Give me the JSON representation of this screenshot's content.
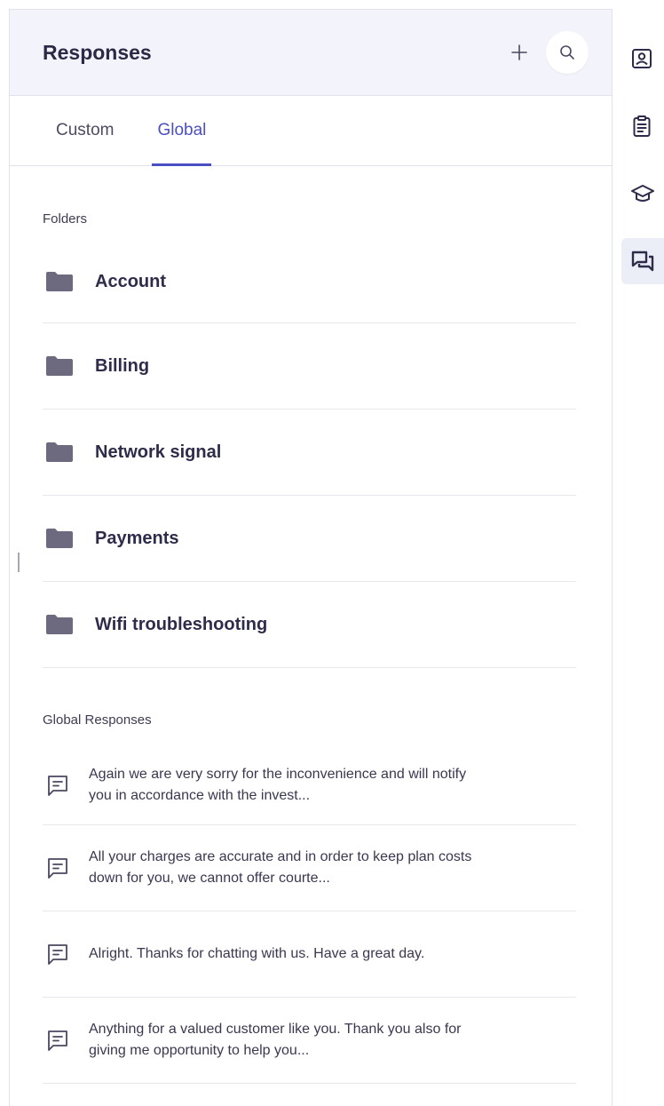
{
  "header": {
    "title": "Responses"
  },
  "tabs": [
    {
      "label": "Custom",
      "active": false
    },
    {
      "label": "Global",
      "active": true
    }
  ],
  "folders": {
    "label": "Folders",
    "items": [
      {
        "name": "Account"
      },
      {
        "name": "Billing"
      },
      {
        "name": "Network signal"
      },
      {
        "name": "Payments"
      },
      {
        "name": "Wifi troubleshooting"
      }
    ]
  },
  "global_responses": {
    "label": "Global Responses",
    "items": [
      {
        "text": "Again we are very sorry for the inconvenience and will notify you in accordance with the invest..."
      },
      {
        "text": "All your charges are accurate and in order to keep plan costs down for you, we cannot offer courte..."
      },
      {
        "text": "Alright. Thanks for chatting with us. Have a great day."
      },
      {
        "text": "Anything for a valued customer like you. Thank you also for giving me opportunity to help you..."
      }
    ]
  },
  "rail": [
    {
      "icon": "contact-card-icon",
      "active": false
    },
    {
      "icon": "clipboard-icon",
      "active": false
    },
    {
      "icon": "graduation-cap-icon",
      "active": false
    },
    {
      "icon": "chat-bubbles-icon",
      "active": true
    }
  ],
  "colors": {
    "accent": "#4b4fc2",
    "header_bg": "#f3f4fb",
    "icon": "#6d6a7f",
    "text": "#2e2c4a"
  }
}
